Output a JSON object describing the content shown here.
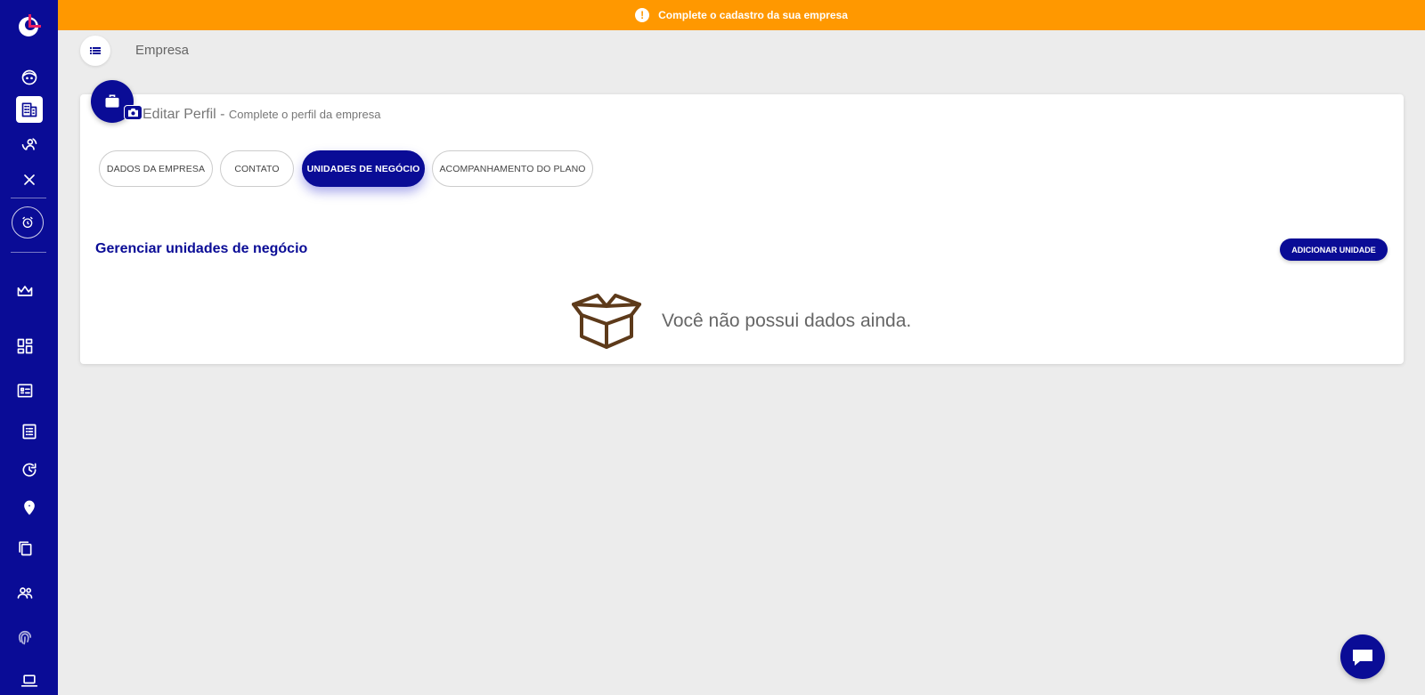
{
  "banner": {
    "message": "Complete o cadastro da sua empresa",
    "icon": "alert-circle-icon",
    "color": "#ff9800"
  },
  "breadcrumb": {
    "icon": "list-icon",
    "title": "Empresa"
  },
  "sidebar": {
    "color": "#0a0c96",
    "icons": [
      "logo-icon",
      "face-icon",
      "building-icon",
      "people-sync-icon",
      "close-icon",
      "alarm-icon",
      "crown-icon",
      "dashboard-icon",
      "card-icon",
      "list-icon",
      "history-icon",
      "location-pin-icon",
      "copy-icon",
      "group-icon",
      "fingerprint-icon",
      "laptop-icon"
    ]
  },
  "profile": {
    "title": "Editar Perfil",
    "separator": " - ",
    "subtitle": "Complete o perfil da empresa",
    "badge_icon": "briefcase-icon",
    "camera_icon": "camera-icon"
  },
  "tabs": [
    {
      "label": "DADOS DA EMPRESA",
      "active": false
    },
    {
      "label": "CONTATO",
      "active": false
    },
    {
      "label": "UNIDADES DE NEGÓCIO",
      "active": true
    },
    {
      "label": "ACOMPANHAMENTO DO PLANO",
      "active": false
    }
  ],
  "section": {
    "title": "Gerenciar unidades de negócio",
    "add_button": "ADICIONAR UNIDADE"
  },
  "empty_state": {
    "icon": "open-box-icon",
    "message": "Você não possui dados ainda.",
    "icon_color": "#5d3a1a"
  },
  "chat": {
    "icon": "chat-bubble-icon"
  }
}
